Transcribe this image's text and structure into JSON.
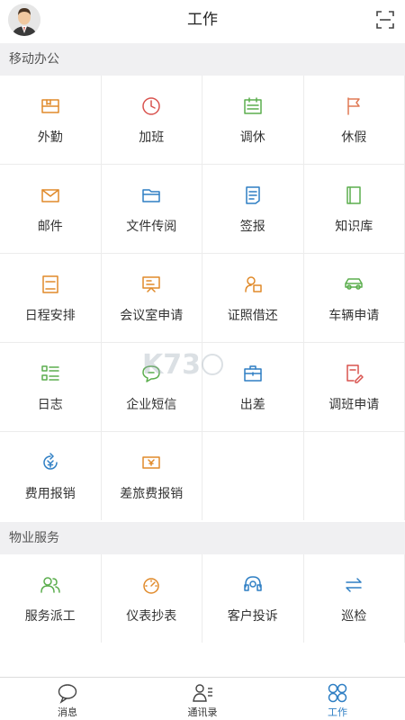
{
  "header": {
    "title": "工作",
    "avatar_icon": "user-avatar",
    "scan_icon": "scan-icon"
  },
  "sections": [
    {
      "title": "移动办公",
      "items": [
        {
          "label": "外勤",
          "icon": "field-work-icon",
          "color": "#e08a2a"
        },
        {
          "label": "加班",
          "icon": "clock-icon",
          "color": "#d9534f"
        },
        {
          "label": "调休",
          "icon": "calendar-icon",
          "color": "#5cae4e"
        },
        {
          "label": "休假",
          "icon": "flag-icon",
          "color": "#e07a55"
        },
        {
          "label": "邮件",
          "icon": "mail-icon",
          "color": "#e08a2a"
        },
        {
          "label": "文件传阅",
          "icon": "folder-icon",
          "color": "#2f7fc4"
        },
        {
          "label": "签报",
          "icon": "document-icon",
          "color": "#2f7fc4"
        },
        {
          "label": "知识库",
          "icon": "book-icon",
          "color": "#5cae4e"
        },
        {
          "label": "日程安排",
          "icon": "schedule-icon",
          "color": "#e08a2a"
        },
        {
          "label": "会议室申请",
          "icon": "meeting-board-icon",
          "color": "#e08a2a"
        },
        {
          "label": "证照借还",
          "icon": "id-card-icon",
          "color": "#e08a2a"
        },
        {
          "label": "车辆申请",
          "icon": "car-icon",
          "color": "#5cae4e"
        },
        {
          "label": "日志",
          "icon": "list-icon",
          "color": "#5cae4e"
        },
        {
          "label": "企业短信",
          "icon": "chat-bubble-icon",
          "color": "#5cae4e"
        },
        {
          "label": "出差",
          "icon": "briefcase-icon",
          "color": "#2f7fc4"
        },
        {
          "label": "调班申请",
          "icon": "edit-document-icon",
          "color": "#d9534f"
        },
        {
          "label": "费用报销",
          "icon": "money-refresh-icon",
          "color": "#2f7fc4"
        },
        {
          "label": "差旅费报销",
          "icon": "money-bill-icon",
          "color": "#e08a2a"
        }
      ]
    },
    {
      "title": "物业服务",
      "items": [
        {
          "label": "服务派工",
          "icon": "people-icon",
          "color": "#5cae4e"
        },
        {
          "label": "仪表抄表",
          "icon": "meter-icon",
          "color": "#e08a2a"
        },
        {
          "label": "客户投诉",
          "icon": "headset-icon",
          "color": "#2f7fc4"
        },
        {
          "label": "巡检",
          "icon": "swap-arrows-icon",
          "color": "#2f7fc4"
        }
      ]
    }
  ],
  "tabbar": [
    {
      "label": "消息",
      "icon": "message-icon",
      "active": false
    },
    {
      "label": "通讯录",
      "icon": "contacts-icon",
      "active": false
    },
    {
      "label": "工作",
      "icon": "work-grid-icon",
      "active": true
    }
  ],
  "colors": {
    "accent": "#2f7fc4",
    "section_bg": "#f0f0f2",
    "divider": "#ececec"
  }
}
